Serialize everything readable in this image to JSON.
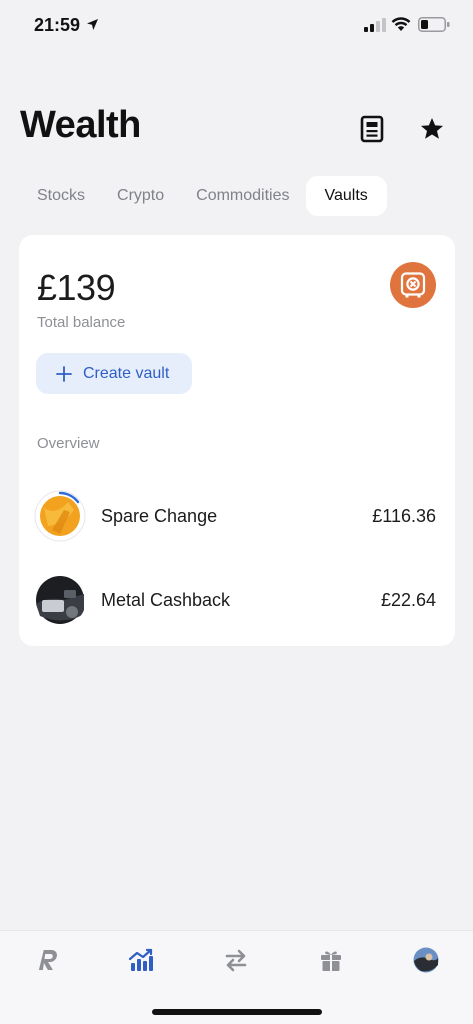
{
  "status_bar": {
    "time": "21:59"
  },
  "header": {
    "title": "Wealth"
  },
  "tabs": [
    {
      "label": "Stocks",
      "active": false
    },
    {
      "label": "Crypto",
      "active": false
    },
    {
      "label": "Commodities",
      "active": false
    },
    {
      "label": "Vaults",
      "active": true
    }
  ],
  "summary": {
    "balance": "£139",
    "balance_label": "Total balance",
    "create_label": "Create vault",
    "overview_label": "Overview"
  },
  "vaults": [
    {
      "name": "Spare Change",
      "amount": "£116.36"
    },
    {
      "name": "Metal Cashback",
      "amount": "£22.64"
    }
  ],
  "colors": {
    "accent": "#2f5fc4",
    "vault_badge": "#e0743f",
    "background": "#f2f2f4",
    "card": "#ffffff"
  },
  "icons": {
    "header": [
      "news-icon",
      "star-icon"
    ],
    "tabbar": [
      "revolut-home-icon",
      "wealth-chart-icon",
      "transfer-icon",
      "gift-icon",
      "profile-avatar"
    ]
  }
}
